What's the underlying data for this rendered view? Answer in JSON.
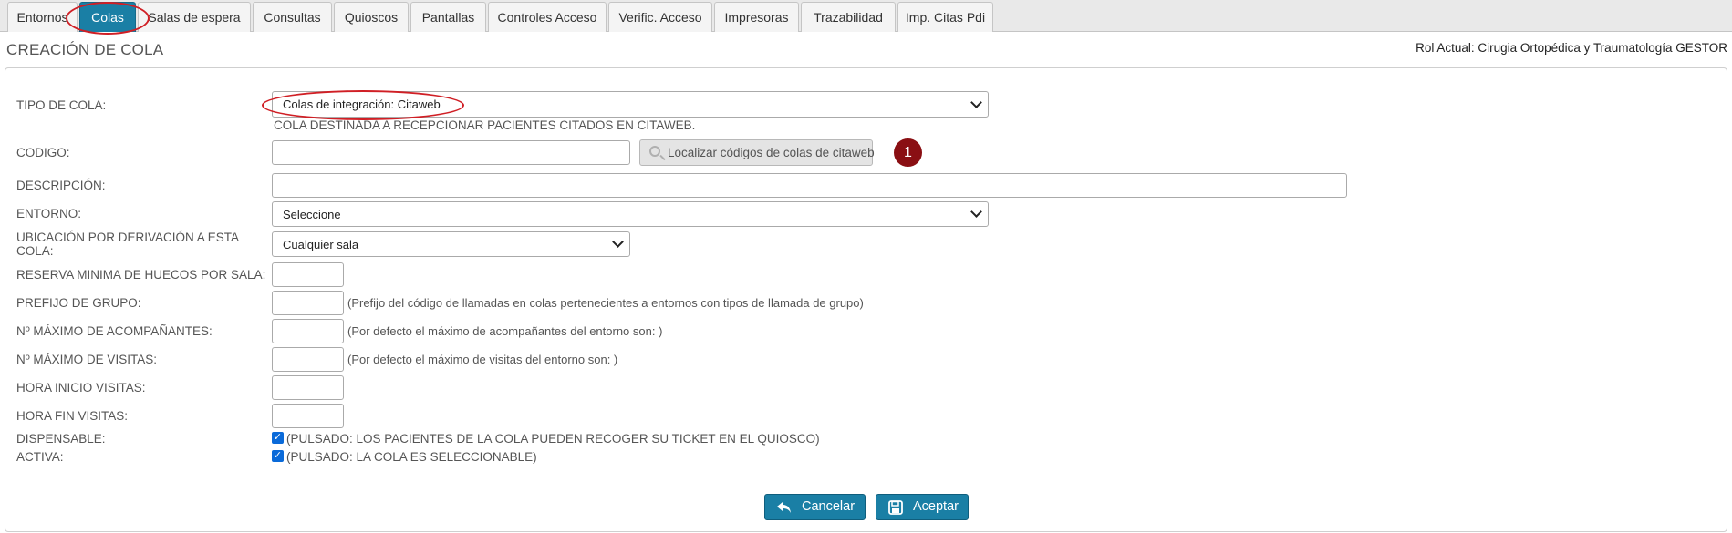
{
  "tabs": [
    {
      "label": "Entornos"
    },
    {
      "label": "Colas"
    },
    {
      "label": "Salas de espera"
    },
    {
      "label": "Consultas"
    },
    {
      "label": "Quioscos"
    },
    {
      "label": "Pantallas"
    },
    {
      "label": "Controles Acceso"
    },
    {
      "label": "Verific. Acceso"
    },
    {
      "label": "Impresoras"
    },
    {
      "label": "Trazabilidad"
    },
    {
      "label": "Imp. Citas Pdi"
    }
  ],
  "page_title": "CREACIÓN DE COLA",
  "rol_actual": "Rol Actual: Cirugia Ortopédica y Traumatología GESTOR",
  "form": {
    "tipo_cola": {
      "label": "TIPO DE COLA:",
      "value": "Colas de integración: Citaweb",
      "description": "COLA DESTINADA A RECEPCIONAR PACIENTES CITADOS EN CITAWEB."
    },
    "codigo": {
      "label": "CODIGO:",
      "value": "",
      "button": "Localizar códigos de colas de citaweb",
      "badge": "1"
    },
    "descripcion": {
      "label": "DESCRIPCIÓN:",
      "value": ""
    },
    "entorno": {
      "label": "ENTORNO:",
      "value": "Seleccione"
    },
    "ubicacion": {
      "label_line1": "UBICACIÓN POR DERIVACIÓN A ESTA",
      "label_line2": "COLA:",
      "value": "Cualquier sala"
    },
    "reserva": {
      "label": "RESERVA MINIMA DE HUECOS POR SALA:",
      "value": ""
    },
    "prefijo": {
      "label": "PREFIJO DE GRUPO:",
      "value": "",
      "hint": "(Prefijo del código de llamadas en colas pertenecientes a entornos con tipos de llamada de grupo)"
    },
    "max_acompanantes": {
      "label": "Nº MÁXIMO DE ACOMPAÑANTES:",
      "value": "",
      "hint": "(Por defecto el máximo de acompañantes del entorno son: )"
    },
    "max_visitas": {
      "label": "Nº MÁXIMO DE VISITAS:",
      "value": "",
      "hint": "(Por defecto el máximo de visitas del entorno son: )"
    },
    "hora_inicio": {
      "label": "HORA INICIO VISITAS:",
      "value": ""
    },
    "hora_fin": {
      "label": "HORA FIN VISITAS:",
      "value": ""
    },
    "dispensable": {
      "label": "DISPENSABLE:",
      "checked": true,
      "hint": "(PULSADO: LOS PACIENTES DE LA COLA PUEDEN RECOGER SU TICKET EN EL QUIOSCO)"
    },
    "activa": {
      "label": "ACTIVA:",
      "checked": true,
      "hint": "(PULSADO: LA COLA ES SELECCIONABLE)"
    }
  },
  "buttons": {
    "cancel": "Cancelar",
    "accept": "Aceptar"
  },
  "icons": {
    "check": "✓",
    "search": "search-icon",
    "undo": "undo-icon",
    "save": "save-icon"
  },
  "colors": {
    "accent": "#1a7fa5",
    "badge": "#8a0f13",
    "annotation": "#d01f25"
  }
}
